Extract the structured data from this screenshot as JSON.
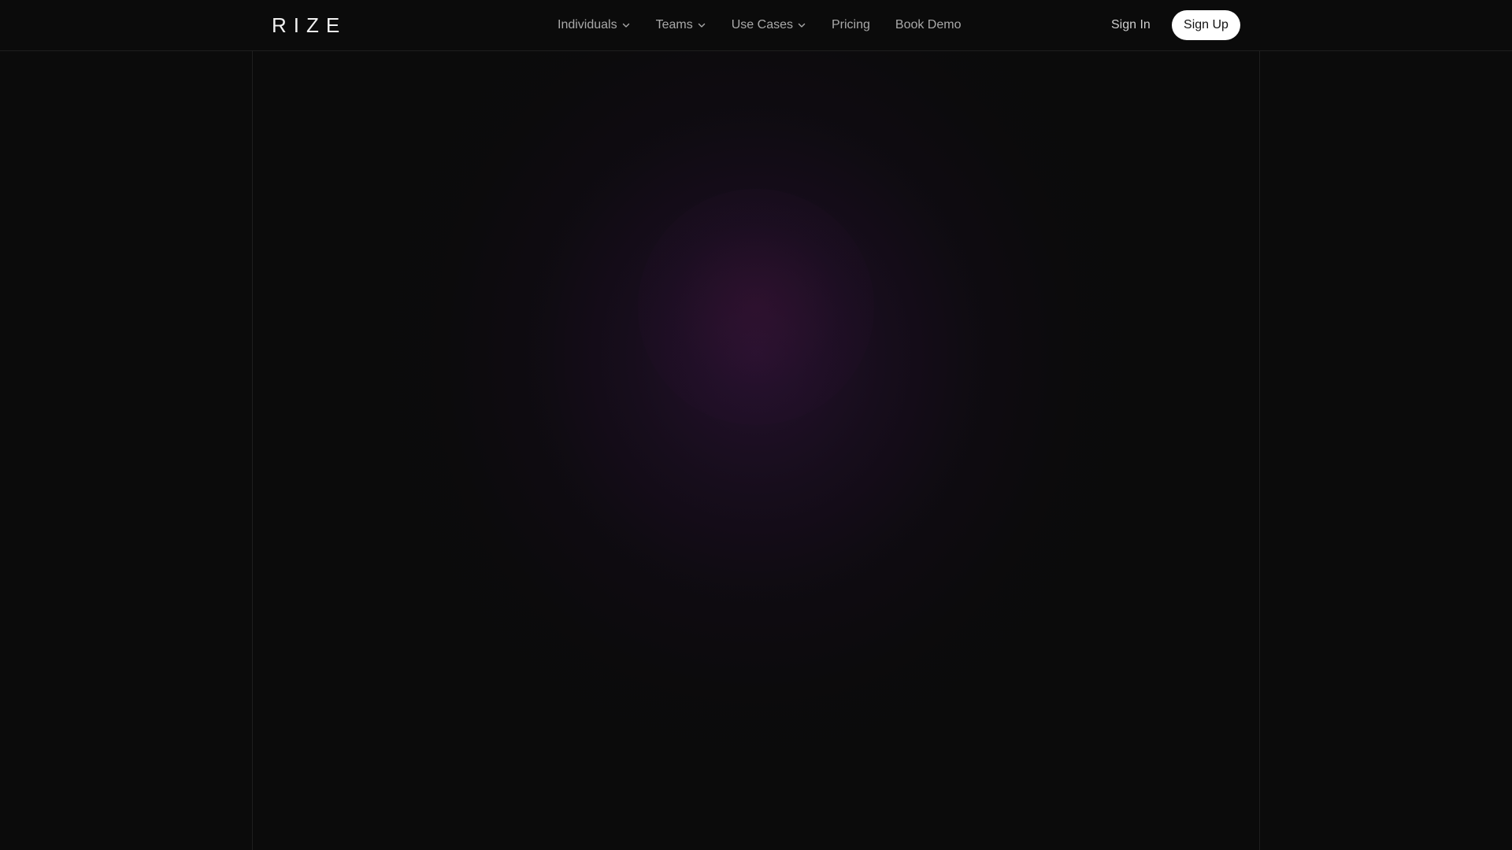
{
  "brand": {
    "logo_text": "RIZE"
  },
  "nav": {
    "items": [
      {
        "label": "Individuals",
        "has_dropdown": true
      },
      {
        "label": "Teams",
        "has_dropdown": true
      },
      {
        "label": "Use Cases",
        "has_dropdown": true
      },
      {
        "label": "Pricing",
        "has_dropdown": false
      },
      {
        "label": "Book Demo",
        "has_dropdown": false
      }
    ],
    "sign_in_label": "Sign In",
    "sign_up_label": "Sign Up"
  },
  "icons": {
    "dropdown": "chevron-down-icon"
  },
  "colors": {
    "background": "#0b0b0b",
    "accent_glow": "#3a1648",
    "button_bg": "#ffffff",
    "button_text": "#111111",
    "nav_text": "#a9a9a9"
  }
}
